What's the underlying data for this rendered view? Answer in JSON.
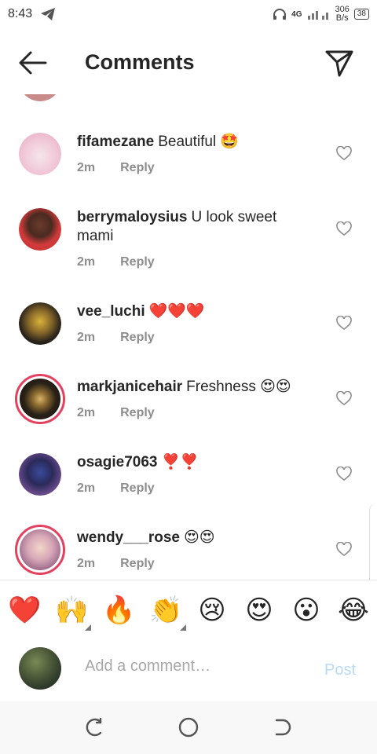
{
  "status_bar": {
    "time": "8:43",
    "network": "4G",
    "net_speed_value": "306",
    "net_speed_unit": "B/s",
    "battery": "38"
  },
  "header": {
    "title": "Comments"
  },
  "comments": [
    {
      "username": "fifamezane",
      "text": "Beautiful 🤩",
      "time": "2m",
      "reply_label": "Reply",
      "avatar_color": "#f0c6d6"
    },
    {
      "username": "berrymaloysius",
      "text": "U look sweet mami",
      "time": "2m",
      "reply_label": "Reply",
      "avatar_color": "#d23b3b"
    },
    {
      "username": "vee_luchi",
      "text": "❤️❤️❤️",
      "time": "2m",
      "reply_label": "Reply",
      "avatar_color": "#3a3020"
    },
    {
      "username": "markjanicehair",
      "text": "Freshness 😍😍",
      "time": "2m",
      "reply_label": "Reply",
      "avatar_color": "#2a2218"
    },
    {
      "username": "osagie7063",
      "text": "❣️❣️",
      "time": "2m",
      "reply_label": "Reply",
      "avatar_color": "#5a3c7a"
    },
    {
      "username": "wendy___rose",
      "text": "😍😍",
      "time": "2m",
      "reply_label": "Reply",
      "avatar_color": "#c890a8"
    }
  ],
  "emoji_bar": [
    "❤️",
    "🙌",
    "🔥",
    "👏",
    "😢",
    "😍",
    "😮",
    "😂"
  ],
  "add_comment": {
    "placeholder": "Add a comment…",
    "post_label": "Post"
  },
  "colors": {
    "story_ring": "#e4405f",
    "muted": "#8e8e8e",
    "post_disabled": "#b8daf7"
  }
}
